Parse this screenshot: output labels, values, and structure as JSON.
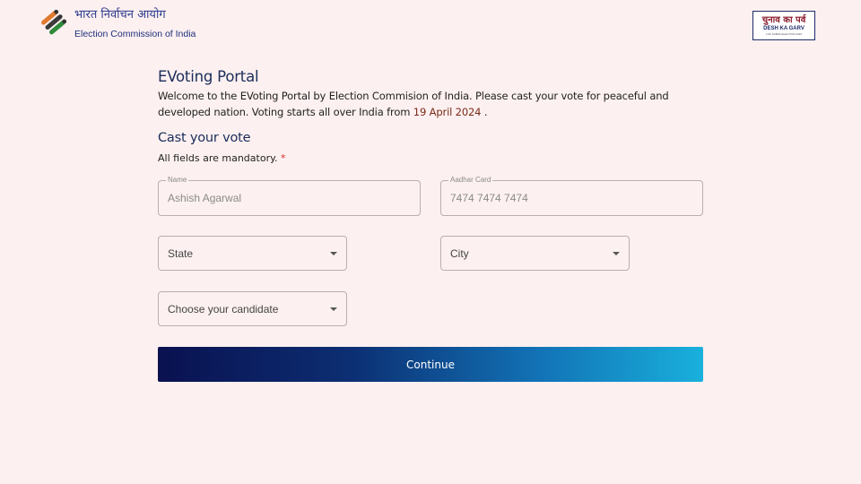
{
  "header": {
    "org_name_hindi": "भारत निर्वाचन आयोग",
    "org_name_english": "Election Commission of India",
    "badge": {
      "hindi": "चुनाव का पर्व",
      "english": "DESH KA GARV",
      "sub": "LOK SABHA ELECTION 2024"
    }
  },
  "portal": {
    "title": "EVoting Portal",
    "welcome_text": "Welcome to the EVoting Portal by Election Commision of India. Please cast your vote for peaceful and developed nation. Voting starts all over India from",
    "start_date": "19 April 2024",
    "welcome_suffix": " ."
  },
  "form": {
    "title": "Cast your vote",
    "mandatory_text": "All fields are mandatory. ",
    "mandatory_marker": "*",
    "name": {
      "label": "Name",
      "value": "Ashish Agarwal"
    },
    "aadhar": {
      "label": "Aadhar Card",
      "value": "7474 7474 7474"
    },
    "state": {
      "label": "State"
    },
    "city": {
      "label": "City"
    },
    "candidate": {
      "label": "Choose your candidate"
    },
    "continue_label": "Continue"
  },
  "colors": {
    "background": "#fdf0f0",
    "title": "#1a2d5a",
    "date": "#7a2a18",
    "button_gradient_start": "#0a1150",
    "button_gradient_end": "#19b0dc"
  }
}
